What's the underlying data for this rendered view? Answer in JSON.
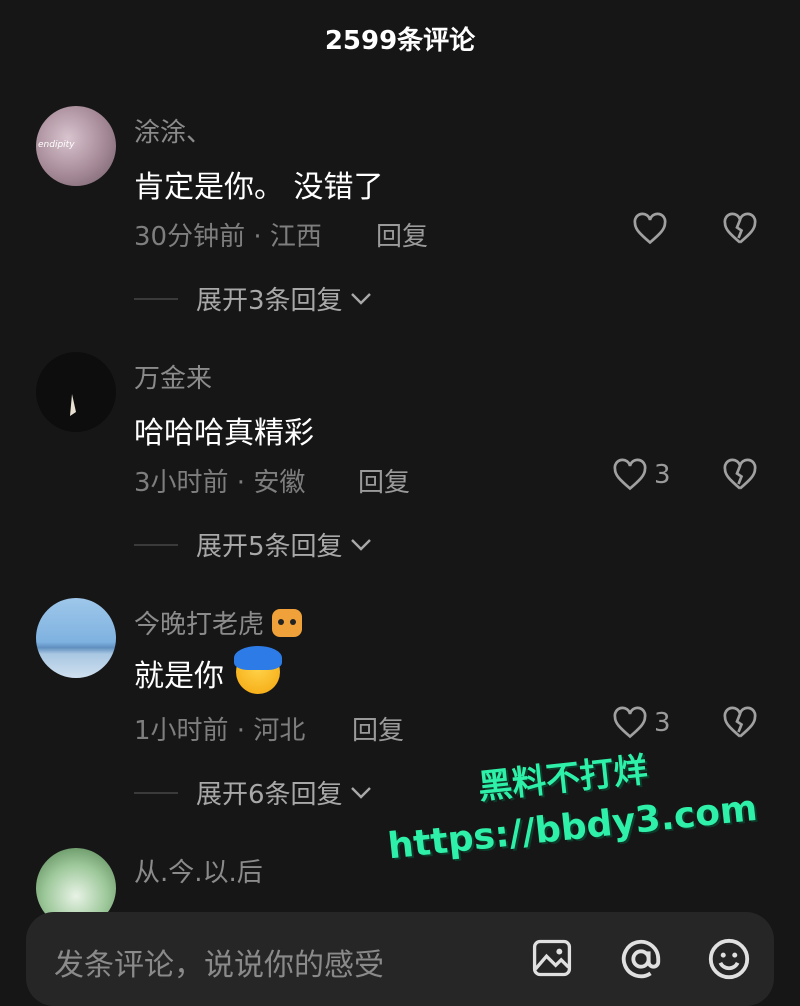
{
  "header": {
    "title": "2599条评论"
  },
  "comments": [
    {
      "user": "涂涂、",
      "avatar_text": "endipity",
      "text": "肯定是你。 没错了",
      "meta": "30分钟前 · 江西",
      "reply_label": "回复",
      "like_count": "",
      "expand_label": "展开3条回复"
    },
    {
      "user": "万金来",
      "text": "哈哈哈真精彩",
      "meta": "3小时前 · 安徽",
      "reply_label": "回复",
      "like_count": "3",
      "expand_label": "展开5条回复"
    },
    {
      "user": "今晚打老虎",
      "text": "就是你",
      "meta": "1小时前 · 河北",
      "reply_label": "回复",
      "like_count": "3",
      "expand_label": "展开6条回复"
    },
    {
      "user": "从.今.以.后"
    }
  ],
  "watermark": {
    "line1": "黑料不打烊",
    "line2": "https://bbdy3.com"
  },
  "input": {
    "placeholder": "发条评论，说说你的感受"
  },
  "icons": {
    "like": "heart-outline-icon",
    "dislike": "broken-heart-icon",
    "expand": "chevron-down-icon",
    "image": "image-icon",
    "mention": "at-icon",
    "emoji": "smiley-icon"
  },
  "colors": {
    "background": "#161616",
    "watermark": "#2ef0a8",
    "input_bg": "#262626"
  }
}
